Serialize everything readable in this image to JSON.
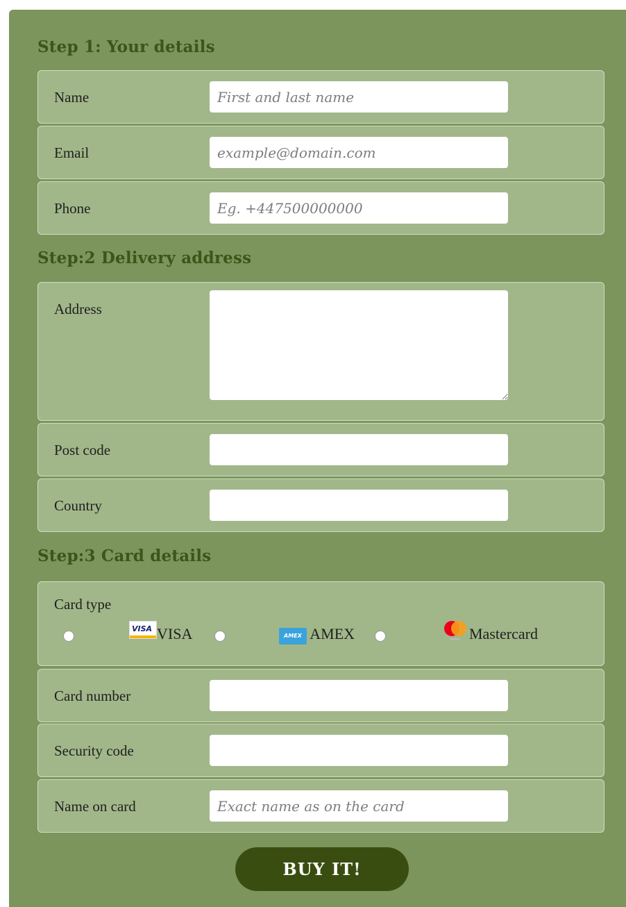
{
  "step1": {
    "title": "Step 1: Your details",
    "name_label": "Name",
    "name_placeholder": "First and last name",
    "email_label": "Email",
    "email_placeholder": "example@domain.com",
    "phone_label": "Phone",
    "phone_placeholder": "Eg. +447500000000"
  },
  "step2": {
    "title": "Step:2 Delivery address",
    "address_label": "Address",
    "postcode_label": "Post code",
    "country_label": "Country"
  },
  "step3": {
    "title": "Step:3 Card details",
    "card_type_label": "Card type",
    "card_options": [
      {
        "label": "VISA",
        "icon": "visa-icon"
      },
      {
        "label": "AMEX",
        "icon": "amex-icon"
      },
      {
        "label": "Mastercard",
        "icon": "mastercard-icon"
      }
    ],
    "card_number_label": "Card number",
    "security_code_label": "Security code",
    "name_on_card_label": "Name on card",
    "name_on_card_placeholder": "Exact name as on the card"
  },
  "submit_label": "BUY IT!",
  "colors": {
    "form_bg": "#7b955c",
    "row_bg": "#a1b789",
    "title": "#3e5418",
    "button": "#3a4d10"
  }
}
